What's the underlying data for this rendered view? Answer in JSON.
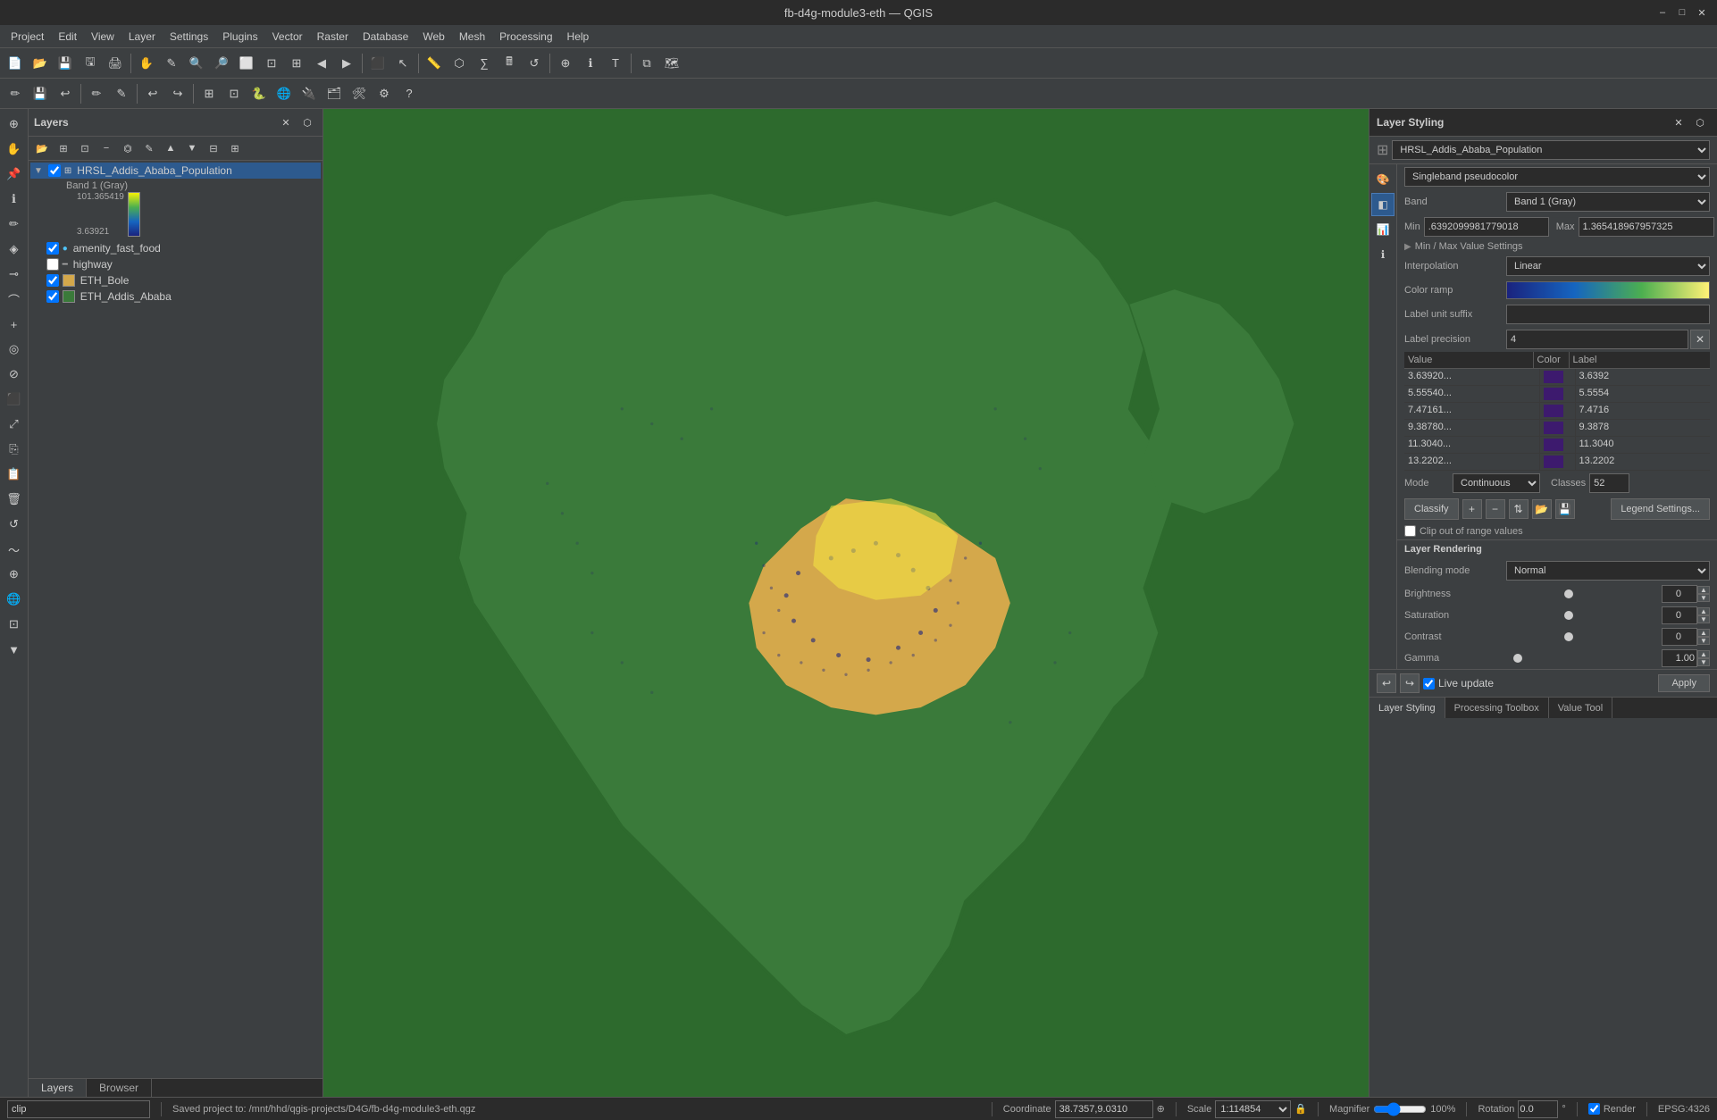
{
  "titleBar": {
    "title": "fb-d4g-module3-eth — QGIS",
    "minimizeBtn": "–",
    "maximizeBtn": "□",
    "closeBtn": "✕"
  },
  "menuBar": {
    "items": [
      "Project",
      "Edit",
      "View",
      "Layer",
      "Settings",
      "Plugins",
      "Vector",
      "Raster",
      "Database",
      "Web",
      "Mesh",
      "Processing",
      "Help"
    ]
  },
  "layers": {
    "title": "Layers",
    "items": [
      {
        "name": "HRSL_Addis_Ababa_Population",
        "checked": true,
        "expanded": true,
        "type": "raster",
        "selected": true
      },
      {
        "name": "Band 1 (Gray)",
        "isSubLabel": true
      },
      {
        "name": "101.365419",
        "isColorMax": true
      },
      {
        "name": "3.63921",
        "isColorMin": true
      },
      {
        "name": "amenity_fast_food",
        "checked": true,
        "type": "point",
        "selected": false
      },
      {
        "name": "highway",
        "checked": false,
        "type": "line",
        "selected": false
      },
      {
        "name": "ETH_Bole",
        "checked": true,
        "type": "polygon",
        "selected": false
      },
      {
        "name": "ETH_Addis_Ababa",
        "checked": true,
        "type": "polygon",
        "selected": false
      }
    ],
    "bottomTabs": [
      "Layers",
      "Browser"
    ]
  },
  "rightPanel": {
    "title": "Layer Styling",
    "layerName": "HRSL_Addis_Ababa_Population",
    "rendererType": "Singleband pseudocolor",
    "band": "Band 1 (Gray)",
    "min": ".6392099981779018",
    "max": "1.365418967957325",
    "minMaxSection": "Min / Max Value Settings",
    "interpolation": "Linear",
    "colorRamp": "",
    "labelUnitSuffix": "",
    "labelPrecision": "4",
    "tableHeaders": [
      "Value",
      "Color",
      "Label"
    ],
    "tableRows": [
      {
        "value": "3.63920...",
        "color": "#3d1a6e",
        "label": "3.6392"
      },
      {
        "value": "5.55540...",
        "color": "#3d1a6e",
        "label": "5.5554"
      },
      {
        "value": "7.47161...",
        "color": "#3d1a6e",
        "label": "7.4716"
      },
      {
        "value": "9.38780...",
        "color": "#3d1a6e",
        "label": "9.3878"
      },
      {
        "value": "11.3040...",
        "color": "#3d1a6e",
        "label": "11.3040"
      },
      {
        "value": "13.2202...",
        "color": "#3d1a6e",
        "label": "13.2202"
      }
    ],
    "mode": "Continuous",
    "classes": "52",
    "classifyBtn": "Classify",
    "legendSettingsBtn": "Legend Settings...",
    "clipOutOfRange": false,
    "clipLabel": "Clip out of range values",
    "layerRendering": "Layer Rendering",
    "blendingMode": "Normal",
    "brightness": "0",
    "saturation": "0",
    "contrast": "0",
    "gamma": "1.00",
    "liveUpdate": "Live update",
    "applyBtn": "Apply",
    "tabs": [
      "Layer Styling",
      "Processing Toolbox",
      "Value Tool"
    ]
  },
  "statusBar": {
    "searchPlaceholder": "clip",
    "savedProject": "Saved project to: /mnt/hhd/qgis-projects/D4G/fb-d4g-module3-eth.qgz",
    "coordinate": "38.7357,9.0310",
    "coordinateLabel": "Coordinate",
    "scale": "1:114854",
    "scaleLabel": "Scale",
    "magnifier": "100%",
    "magnifierLabel": "Magnifier",
    "rotation": "0.0 °",
    "rotationLabel": "Rotation",
    "renderLabel": "Render",
    "epsg": "EPSG:4326"
  }
}
